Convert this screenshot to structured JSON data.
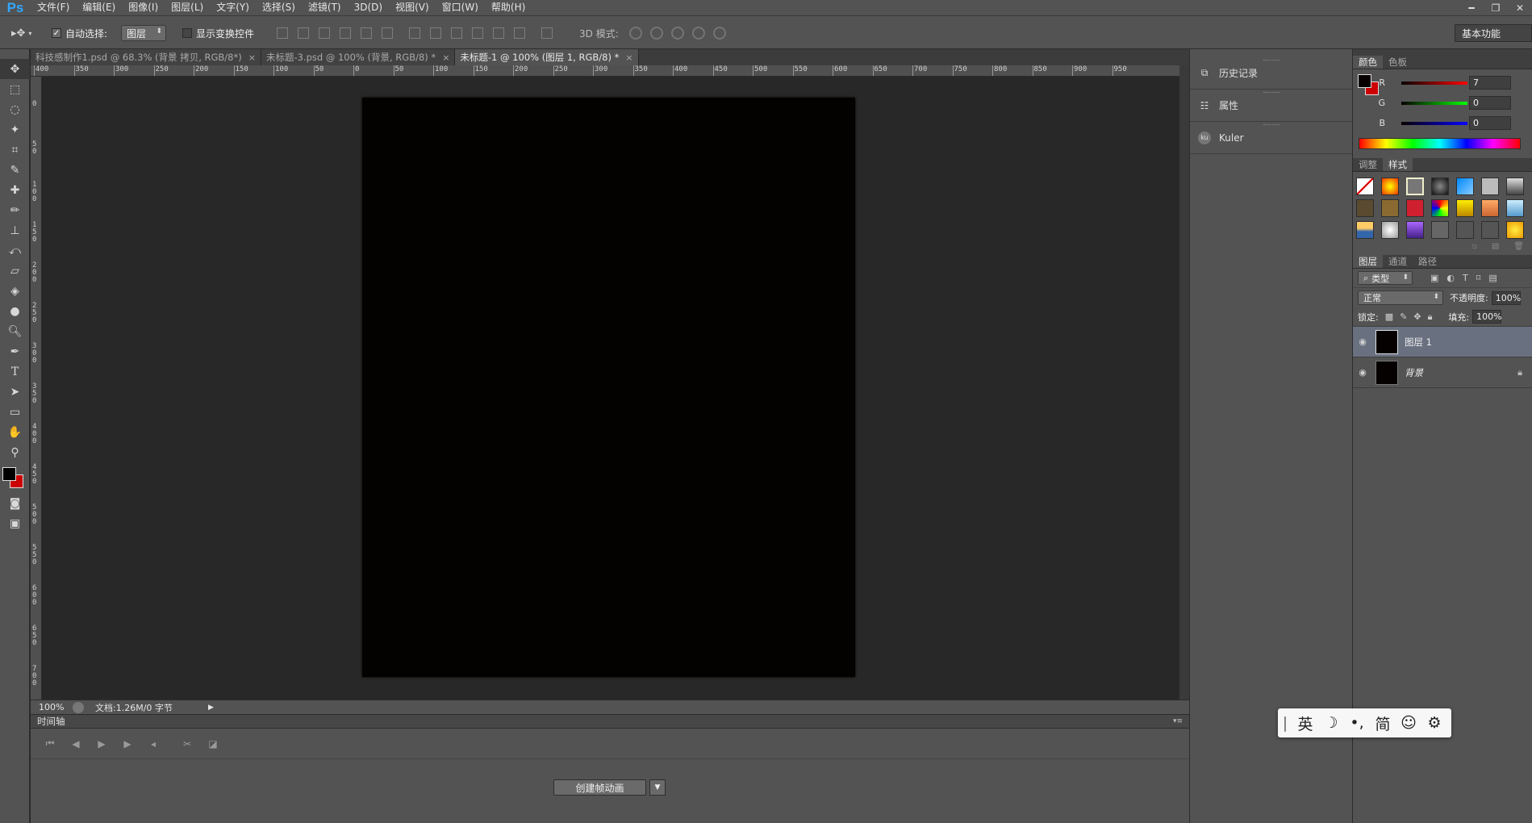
{
  "app": {
    "logo": "Ps"
  },
  "menu": [
    "文件(F)",
    "编辑(E)",
    "图像(I)",
    "图层(L)",
    "文字(Y)",
    "选择(S)",
    "滤镜(T)",
    "3D(D)",
    "视图(V)",
    "窗口(W)",
    "帮助(H)"
  ],
  "window_controls": {
    "minimize": "━",
    "restore": "❐",
    "close": "✕"
  },
  "options": {
    "auto_select_label": "自动选择:",
    "auto_select_checked": true,
    "auto_select_value": "图层",
    "show_transform_label": "显示变换控件",
    "show_transform_checked": false,
    "mode3d_label": "3D 模式:",
    "workspace": "基本功能"
  },
  "tabs": [
    {
      "label": "科技感制作1.psd @ 68.3% (背景 拷贝, RGB/8*)",
      "active": false
    },
    {
      "label": "未标题-3.psd @ 100% (背景, RGB/8) *",
      "active": false
    },
    {
      "label": "未标题-1 @ 100% (图层 1, RGB/8) *",
      "active": true
    }
  ],
  "ruler": {
    "h_labels": [
      "400",
      "350",
      "300",
      "250",
      "200",
      "150",
      "100",
      "50",
      "0",
      "50",
      "100",
      "150",
      "200",
      "250",
      "300",
      "350",
      "400",
      "450",
      "500",
      "550",
      "600",
      "650",
      "700",
      "750",
      "800",
      "850",
      "900",
      "950"
    ],
    "v_labels": [
      "0",
      "5 0",
      "1 0 0",
      "1 5 0",
      "2 0 0",
      "2 5 0",
      "3 0 0",
      "3 5 0",
      "4 0 0",
      "4 5 0",
      "5 0 0",
      "5 5 0",
      "6 0 0",
      "6 5 0",
      "7 0 0"
    ]
  },
  "status": {
    "zoom": "100%",
    "doc_info": "文档:1.26M/0 字节"
  },
  "timeline": {
    "title": "时间轴",
    "create_button": "创建帧动画"
  },
  "mid_panels": [
    {
      "icon": "history-icon",
      "label": "历史记录"
    },
    {
      "icon": "properties-icon",
      "label": "属性"
    },
    {
      "icon": "kuler-icon",
      "label": "Kuler"
    }
  ],
  "color_panel": {
    "tabs": [
      "颜色",
      "色板"
    ],
    "r_label": "R",
    "r_value": "7",
    "g_label": "G",
    "g_value": "0",
    "b_label": "B",
    "b_value": "0",
    "foreground": "#070000",
    "background": "#cc0000"
  },
  "styles_panel": {
    "tabs": [
      "调整",
      "样式"
    ]
  },
  "layers_panel": {
    "tabs": [
      "图层",
      "通道",
      "路径"
    ],
    "filter_label": "类型",
    "blend_mode": "正常",
    "opacity_label": "不透明度:",
    "opacity_value": "100%",
    "lock_label": "锁定:",
    "fill_label": "填充:",
    "fill_value": "100%",
    "layers": [
      {
        "name": "图层 1",
        "selected": true,
        "locked": false
      },
      {
        "name": "背景",
        "selected": false,
        "locked": true
      }
    ]
  },
  "ime": {
    "cursor": "|",
    "lang": "英",
    "moon": "☽",
    "punct": "•,",
    "charset": "简",
    "emoji": "☺",
    "settings": "⚙"
  }
}
